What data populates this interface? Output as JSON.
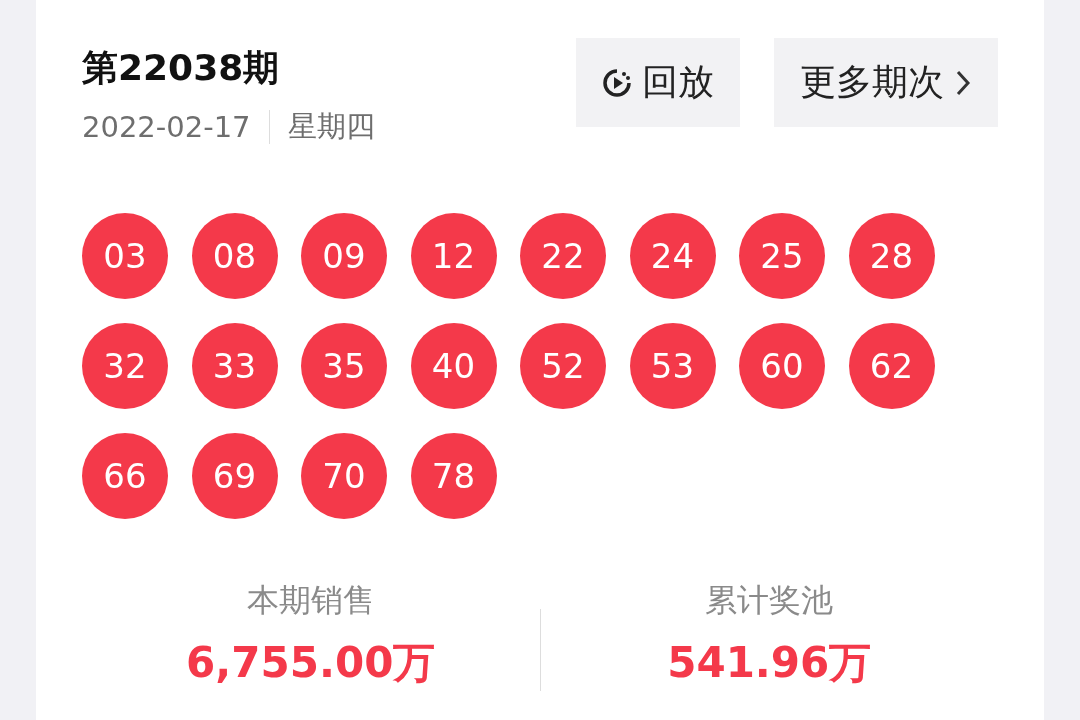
{
  "issue": {
    "title": "第22038期",
    "date": "2022-02-17",
    "weekday": "星期四"
  },
  "buttons": [
    {
      "kind": "replay",
      "label": "回放"
    },
    {
      "kind": "more",
      "label": "更多期次"
    }
  ],
  "balls": [
    "03",
    "08",
    "09",
    "12",
    "22",
    "24",
    "25",
    "28",
    "32",
    "33",
    "35",
    "40",
    "52",
    "53",
    "60",
    "62",
    "66",
    "69",
    "70",
    "78"
  ],
  "stats": [
    {
      "label": "本期销售",
      "value": "6,755.00万"
    },
    {
      "label": "累计奖池",
      "value": "541.96万"
    }
  ]
}
